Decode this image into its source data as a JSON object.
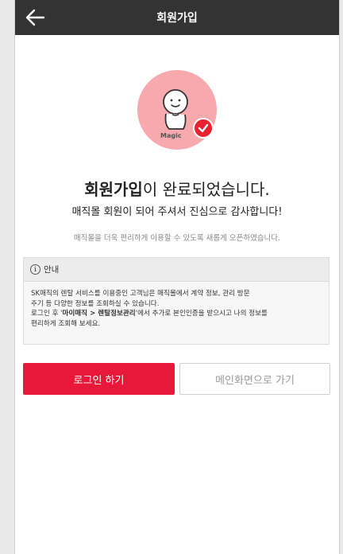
{
  "header": {
    "title": "회원가입",
    "back_icon": "arrow-left-icon"
  },
  "hero": {
    "logo_text": "Magic",
    "circle_color": "#f7a9ae",
    "check_color": "#e8212f"
  },
  "message": {
    "headline_bold": "회원가입",
    "headline_rest": "이 완료되었습니다.",
    "subline": "매직몰 회원이 되어 주셔서 진심으로 감사합니다!",
    "note": "매직몰을 더욱 편리하게 이용할 수 있도록 새롭게 오픈하였습니다."
  },
  "info": {
    "icon": "info-icon",
    "icon_glyph": "i",
    "title": "안내",
    "line1": "SK매직의 렌탈 서비스를 이용중인 고객님은 매직몰에서 계약 정보, 관리 방문",
    "line2": "주기 등 다양한 정보를 조회하실 수 있습니다.",
    "line3_pre": "로그인 후 '",
    "line3_bold": "마이매직 > 렌탈정보관리",
    "line3_post": "'에서 추가로 본인인증을 받으시고 나의 정보를",
    "line4": "편리하게 조회해 보세요."
  },
  "buttons": {
    "login": "로그인 하기",
    "main": "메인화면으로 가기",
    "accent": "#e8183a"
  }
}
